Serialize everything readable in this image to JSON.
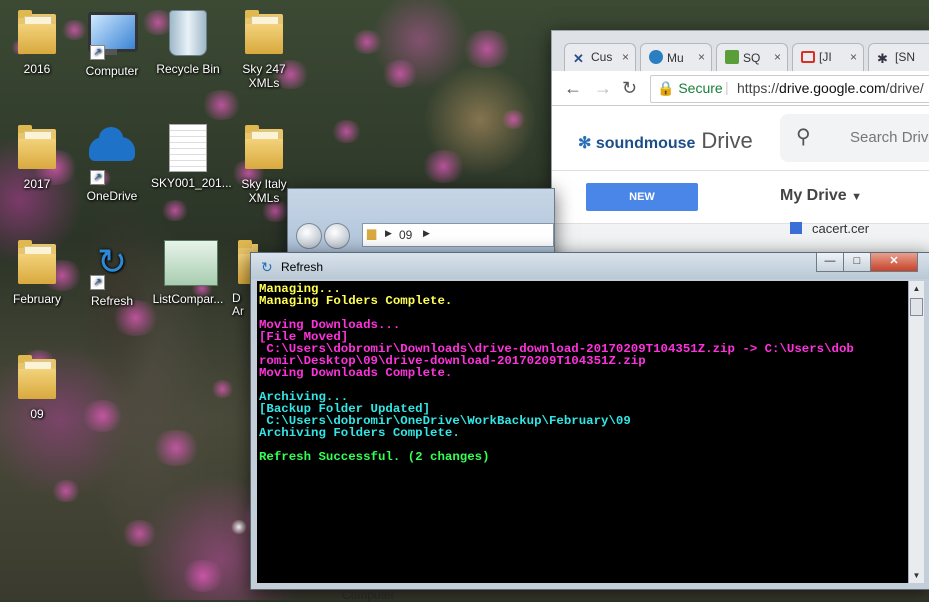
{
  "desktop": {
    "icons": [
      {
        "label": "2016",
        "type": "folder"
      },
      {
        "label": "Computer",
        "type": "computer"
      },
      {
        "label": "Recycle Bin",
        "type": "recycle"
      },
      {
        "label": "Sky 247 XMLs",
        "type": "folder"
      },
      {
        "label": "2017",
        "type": "folder"
      },
      {
        "label": "OneDrive",
        "type": "cloud"
      },
      {
        "label": "SKY001_201...",
        "type": "file"
      },
      {
        "label": "Sky Italy XMLs",
        "type": "folder"
      },
      {
        "label": "February",
        "type": "folder"
      },
      {
        "label": "Refresh",
        "type": "refresh"
      },
      {
        "label": "ListCompar...",
        "type": "app"
      },
      {
        "label": "09",
        "type": "folder"
      }
    ],
    "partial_label": "D\nAr"
  },
  "browser": {
    "tabs": [
      {
        "label": "Cus",
        "icon": "tools-icon"
      },
      {
        "label": "Mu",
        "icon": "soundmouse-icon"
      },
      {
        "label": "SQ",
        "icon": "sql-icon"
      },
      {
        "label": "[JI",
        "icon": "gmail-icon"
      },
      {
        "label": "[SN",
        "icon": "bug-icon"
      }
    ],
    "secure_label": "Secure",
    "url_scheme": "https://",
    "url_host": "drive.google.com",
    "url_path": "/drive/",
    "brand": "soundmouse",
    "product": "Drive",
    "search_placeholder": "Search Drive",
    "new_label": "NEW",
    "my_drive_label": "My Drive",
    "file_name": "cacert.cer"
  },
  "explorer": {
    "path_folder": "09"
  },
  "console": {
    "title": "Refresh",
    "buttons": {
      "minimize": "—",
      "maximize": "□",
      "close": "✕"
    },
    "lines": [
      {
        "text": "Managing...",
        "color": "yellow"
      },
      {
        "text": "Managing Folders Complete.",
        "color": "yellow"
      },
      {
        "text": "",
        "color": "yellow"
      },
      {
        "text": "Moving Downloads...",
        "color": "magenta"
      },
      {
        "text": "[File Moved]",
        "color": "magenta"
      },
      {
        "text": " C:\\Users\\dobromir\\Downloads\\drive-download-20170209T104351Z.zip -> C:\\Users\\dob",
        "color": "magenta"
      },
      {
        "text": "romir\\Desktop\\09\\drive-download-20170209T104351Z.zip",
        "color": "magenta"
      },
      {
        "text": "Moving Downloads Complete.",
        "color": "magenta"
      },
      {
        "text": "",
        "color": "magenta"
      },
      {
        "text": "Archiving...",
        "color": "cyan"
      },
      {
        "text": "[Backup Folder Updated]",
        "color": "cyan"
      },
      {
        "text": " C:\\Users\\dobromir\\OneDrive\\WorkBackup\\February\\09",
        "color": "cyan"
      },
      {
        "text": "Archiving Folders Complete.",
        "color": "cyan"
      },
      {
        "text": "",
        "color": "cyan"
      },
      {
        "text": "Refresh Successful. (2 changes)",
        "color": "green"
      }
    ]
  },
  "behind_window_label": "Computer",
  "colors": {
    "yellow": "#ffff55",
    "magenta": "#ff33dd",
    "cyan": "#33e6e6",
    "green": "#33ff55",
    "drive_new": "#4a86e8"
  }
}
